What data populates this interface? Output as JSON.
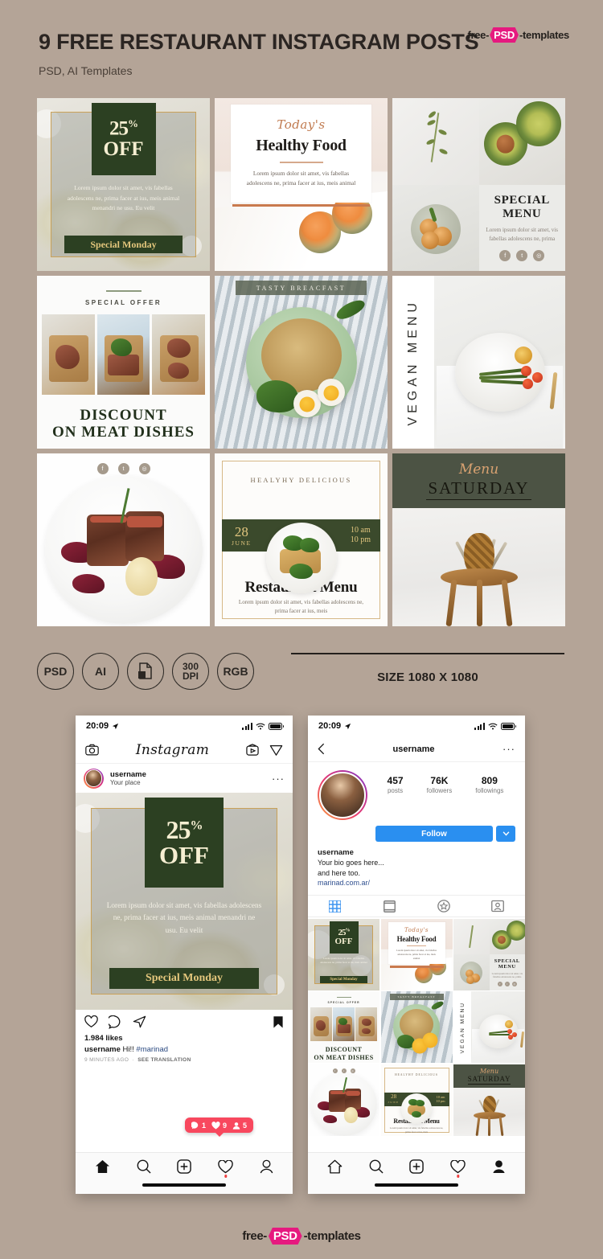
{
  "header": {
    "title": "9 FREE RESTAURANT INSTAGRAM POSTS",
    "subtitle": "PSD, AI Templates",
    "logo": {
      "pre": "free-",
      "mid": "PSD",
      "post": "-templates"
    }
  },
  "templates": [
    {
      "id": "discount-25-off",
      "badge_percent": "25",
      "badge_sup": "%",
      "badge_off": "OFF",
      "body": "Lorem ipsum dolor sit amet, vis fabellas adolescens ne, prima facer at ius, meis animal menandri ne usu. Eu velit",
      "button": "Special Monday"
    },
    {
      "id": "healthy-food",
      "script": "Today's",
      "title": "Healthy Food",
      "body": "Lorem ipsum dolor sit amet, vis fabellas adolescens ne, prima facer at ius, meis animal"
    },
    {
      "id": "special-menu",
      "title_line1": "SPECIAL",
      "title_line2": "MENU",
      "body": "Lorem ipsum dolor sit amet, vis fabellas adolescens ne, prima",
      "socials": [
        "f",
        "t",
        "ig"
      ]
    },
    {
      "id": "discount-meat",
      "kicker": "SPECIAL OFFER",
      "title_line1": "DISCOUNT",
      "title_line2": "ON MEAT DISHES"
    },
    {
      "id": "tasty-breacfast",
      "label": "TASTY BREACFAST"
    },
    {
      "id": "vegan-menu",
      "label": "VEGAN MENU"
    },
    {
      "id": "steak-plate",
      "socials": [
        "f",
        "t",
        "ig"
      ]
    },
    {
      "id": "restaurant-menu",
      "kicker": "HEALYHY DELICIOUS",
      "date_day": "28",
      "date_month": "JUNE",
      "hours_line1": "10 am",
      "hours_line2": "10 pm",
      "title": "Restaurant Menu",
      "body": "Lorem ipsum dolor sit amet, vis fabellas adolescens ne, prima facer at ius, meis"
    },
    {
      "id": "menu-saturday",
      "script": "Menu",
      "title": "SATURDAY"
    }
  ],
  "specs": {
    "badges": [
      "PSD",
      "AI",
      "file-icon",
      "300\nDPI",
      "RGB"
    ],
    "badge_labels": [
      {
        "text": "PSD",
        "type": "text"
      },
      {
        "text": "AI",
        "type": "text"
      },
      {
        "text": "",
        "type": "icon",
        "icon": "file-copy-icon"
      },
      {
        "text": "300 DPI",
        "type": "stacked",
        "line1": "300",
        "line2": "DPI"
      },
      {
        "text": "RGB",
        "type": "text"
      }
    ],
    "size_label": "SIZE 1080 X 1080"
  },
  "phone_feed": {
    "status": {
      "time": "20:09",
      "location_icon": "location-arrow-icon"
    },
    "app_title": "Instagram",
    "top_icons": [
      "camera-icon",
      "igtv-icon",
      "direct-message-icon"
    ],
    "post": {
      "username": "username",
      "place": "Your place",
      "more": "···",
      "likes": "1.984 likes",
      "caption_user": "username",
      "caption_text": "Hi!!",
      "caption_tag": "#marinad",
      "time_ago": "9 MINUTES AGO",
      "see_translation": "SEE TRANSLATION"
    },
    "notifications": [
      {
        "icon": "comment-icon",
        "count": "1"
      },
      {
        "icon": "heart-icon",
        "count": "9"
      },
      {
        "icon": "person-icon",
        "count": "5"
      }
    ],
    "tabs": [
      "home-icon",
      "search-icon",
      "add-post-icon",
      "activity-heart-icon",
      "profile-icon"
    ]
  },
  "phone_profile": {
    "status": {
      "time": "20:09",
      "location_icon": "location-arrow-icon"
    },
    "nav": {
      "back": "back-chevron-icon",
      "title": "username",
      "more": "···"
    },
    "stats": [
      {
        "number": "457",
        "label": "posts"
      },
      {
        "number": "76K",
        "label": "followers"
      },
      {
        "number": "809",
        "label": "followings"
      }
    ],
    "follow_button": "Follow",
    "bio": {
      "name": "username",
      "line1": "Your bio goes here...",
      "line2": "and here too.",
      "link": "marinad.com.ar/"
    },
    "tabs": [
      "grid-icon",
      "feed-icon",
      "star-icon",
      "tagged-icon"
    ],
    "nav_tabs": [
      "home-icon",
      "search-icon",
      "add-post-icon",
      "activity-heart-icon",
      "profile-icon"
    ]
  },
  "footer": {
    "pre": "free-",
    "mid": "PSD",
    "post": "-templates"
  },
  "colors": {
    "background": "#b4a497",
    "dark_green": "#2c4022",
    "band_green": "#3b4a2c",
    "olive": "#4c5344",
    "gold": "#d6b887",
    "copper": "#c07a4f",
    "instagram_blue": "#2a8ff0",
    "notification_red": "#f8485e",
    "brand_pink": "#e6197f"
  }
}
